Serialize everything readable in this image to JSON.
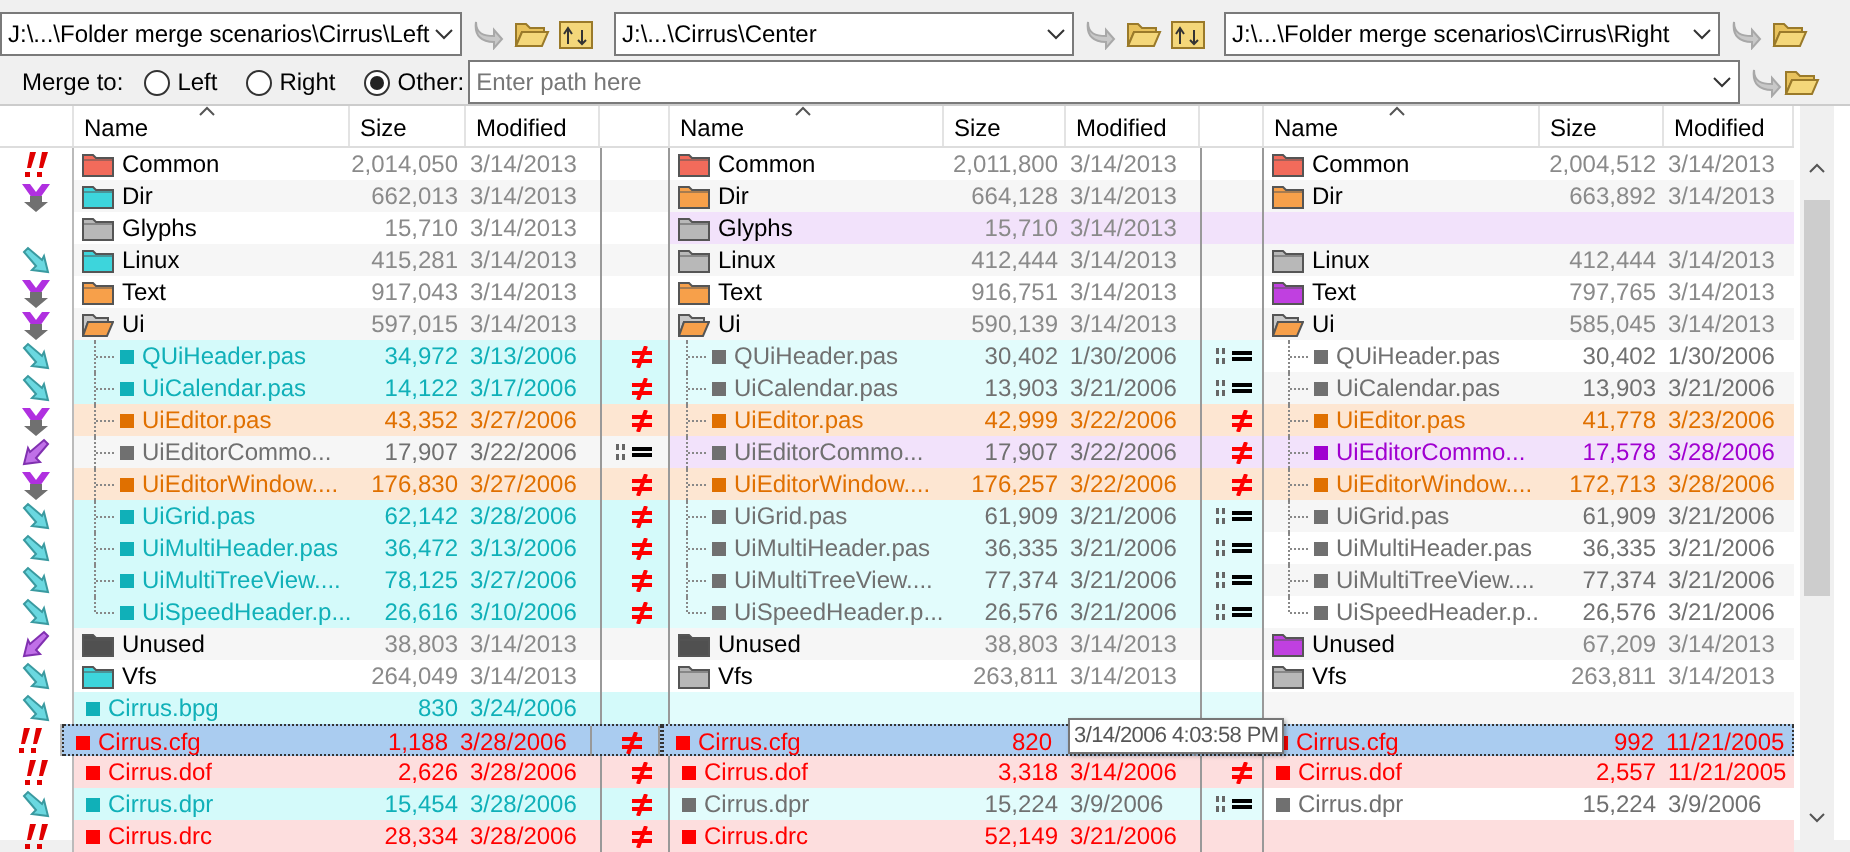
{
  "panes": [
    {
      "path": "J:\\...\\Folder merge scenarios\\Cirrus\\Left",
      "columns": [
        "Name",
        "Size",
        "Modified"
      ]
    },
    {
      "path": "J:\\...\\Cirrus\\Center",
      "columns": [
        "Name",
        "Size",
        "Modified"
      ]
    },
    {
      "path": "J:\\...\\Folder merge scenarios\\Cirrus\\Right",
      "columns": [
        "Name",
        "Size",
        "Modified"
      ]
    }
  ],
  "merge_to": {
    "label": "Merge to:",
    "options": [
      {
        "label": "Left",
        "selected": false
      },
      {
        "label": "Right",
        "selected": false
      },
      {
        "label": "Other:",
        "selected": true
      }
    ],
    "path": {
      "placeholder": "Enter path here"
    }
  },
  "rows": [
    {
      "kind": "conflict",
      "selected": false,
      "left": {
        "name": "Common",
        "size": "2,014,050",
        "modified": "3/14/2013",
        "kind": "folder",
        "color": "#f26b5b"
      },
      "center": {
        "name": "Common",
        "size": "2,011,800",
        "modified": "3/14/2013",
        "kind": "folder",
        "color": "#f26b5b"
      },
      "right": {
        "name": "Common",
        "size": "2,004,512",
        "modified": "3/14/2013",
        "kind": "folder",
        "color": "#f26b5b"
      }
    },
    {
      "kind": "merge",
      "selected": false,
      "left": {
        "name": "Dir",
        "size": "662,013",
        "modified": "3/14/2013",
        "kind": "folder",
        "color": "#3dd5dc"
      },
      "center": {
        "name": "Dir",
        "size": "664,128",
        "modified": "3/14/2013",
        "kind": "folder",
        "color": "#f7a04a"
      },
      "right": {
        "name": "Dir",
        "size": "663,892",
        "modified": "3/14/2013",
        "kind": "folder",
        "color": "#f7a04a"
      }
    },
    {
      "selected": false,
      "left": {
        "name": "Glyphs",
        "size": "15,710",
        "modified": "3/14/2013",
        "kind": "folder",
        "color": "#b8b8b8"
      },
      "center": {
        "name": "Glyphs",
        "size": "15,710",
        "modified": "3/14/2013",
        "kind": "folder",
        "color": "#b8b8b8",
        "shade": {
          "color": "#f2e2fb"
        }
      },
      "right": {
        "shade": {
          "color": "#f2e2fb"
        }
      }
    },
    {
      "kind": "copy_right",
      "selected": false,
      "left": {
        "name": "Linux",
        "size": "415,281",
        "modified": "3/14/2013",
        "kind": "folder",
        "color": "#3dd5dc"
      },
      "center": {
        "name": "Linux",
        "size": "412,444",
        "modified": "3/14/2013",
        "kind": "folder",
        "color": "#b8b8b8"
      },
      "right": {
        "name": "Linux",
        "size": "412,444",
        "modified": "3/14/2013",
        "kind": "folder",
        "color": "#b8b8b8"
      }
    },
    {
      "kind": "merge",
      "selected": false,
      "left": {
        "name": "Text",
        "size": "917,043",
        "modified": "3/14/2013",
        "kind": "folder",
        "color": "#f7a04a"
      },
      "center": {
        "name": "Text",
        "size": "916,751",
        "modified": "3/14/2013",
        "kind": "folder",
        "color": "#f7a04a"
      },
      "right": {
        "name": "Text",
        "size": "797,765",
        "modified": "3/14/2013",
        "kind": "folder",
        "color": "#c040e0"
      }
    },
    {
      "kind": "merge",
      "selected": false,
      "left": {
        "name": "Ui",
        "size": "597,015",
        "modified": "3/14/2013",
        "kind": "open_folder",
        "color": "#f7a04a"
      },
      "center": {
        "name": "Ui",
        "size": "590,139",
        "modified": "3/14/2013",
        "kind": "open_folder",
        "color": "#f7a04a"
      },
      "right": {
        "name": "Ui",
        "size": "585,045",
        "modified": "3/14/2013",
        "kind": "open_folder",
        "color": "#f7a04a"
      },
      "children": [
        {
          "kind": "copy_right",
          "selected": false,
          "compare_left": {
            "kind": "ne"
          },
          "compare_right": {
            "kind": "eq"
          },
          "left": {
            "name": "QUiHeader.pas",
            "size": "34,972",
            "modified": "3/13/2006",
            "kind": "file",
            "color": "#10b0b8",
            "shade": {
              "color": "#d4fafa"
            }
          },
          "center": {
            "name": "QUiHeader.pas",
            "size": "30,402",
            "modified": "1/30/2006",
            "kind": "file",
            "color": "#707070",
            "shade": {
              "color": "#e2fcfc"
            }
          },
          "right": {
            "name": "QUiHeader.pas",
            "size": "30,402",
            "modified": "1/30/2006",
            "kind": "file",
            "color": "#707070"
          }
        },
        {
          "kind": "copy_right",
          "selected": false,
          "compare_left": {
            "kind": "ne"
          },
          "compare_right": {
            "kind": "eq"
          },
          "left": {
            "name": "UiCalendar.pas",
            "size": "14,122",
            "modified": "3/17/2006",
            "kind": "file",
            "color": "#10b0b8",
            "shade": {
              "color": "#d4fafa"
            }
          },
          "center": {
            "name": "UiCalendar.pas",
            "size": "13,903",
            "modified": "3/21/2006",
            "kind": "file",
            "color": "#707070",
            "shade": {
              "color": "#e2fcfc"
            }
          },
          "right": {
            "name": "UiCalendar.pas",
            "size": "13,903",
            "modified": "3/21/2006",
            "kind": "file",
            "color": "#707070"
          }
        },
        {
          "kind": "merge",
          "selected": false,
          "compare_left": {
            "kind": "ne"
          },
          "compare_right": {
            "kind": "ne"
          },
          "left": {
            "name": "UiEditor.pas",
            "size": "43,352",
            "modified": "3/27/2006",
            "kind": "file",
            "color": "#e07000",
            "shade": {
              "color": "#fde6d2"
            }
          },
          "center": {
            "name": "UiEditor.pas",
            "size": "42,999",
            "modified": "3/22/2006",
            "kind": "file",
            "color": "#e07000",
            "shade": {
              "color": "#fde6d2"
            }
          },
          "right": {
            "name": "UiEditor.pas",
            "size": "41,778",
            "modified": "3/23/2006",
            "kind": "file",
            "color": "#e07000",
            "shade": {
              "color": "#fde6d2"
            }
          }
        },
        {
          "kind": "copy_left",
          "selected": false,
          "compare_left": {
            "kind": "eq"
          },
          "compare_right": {
            "kind": "ne"
          },
          "left": {
            "name": "UiEditorCommo...",
            "size": "17,907",
            "modified": "3/22/2006",
            "kind": "file",
            "color": "#707070"
          },
          "center": {
            "name": "UiEditorCommo...",
            "size": "17,907",
            "modified": "3/22/2006",
            "kind": "file",
            "color": "#707070",
            "shade": {
              "color": "#f2e2fb"
            }
          },
          "right": {
            "name": "UiEditorCommo...",
            "size": "17,578",
            "modified": "3/28/2006",
            "kind": "file",
            "color": "#a000d0",
            "shade": {
              "color": "#f2e2fb"
            }
          }
        },
        {
          "kind": "merge",
          "selected": false,
          "compare_left": {
            "kind": "ne"
          },
          "compare_right": {
            "kind": "ne"
          },
          "left": {
            "name": "UiEditorWindow....",
            "size": "176,830",
            "modified": "3/27/2006",
            "kind": "file",
            "color": "#e07000",
            "shade": {
              "color": "#fde6d2"
            }
          },
          "center": {
            "name": "UiEditorWindow....",
            "size": "176,257",
            "modified": "3/22/2006",
            "kind": "file",
            "color": "#e07000",
            "shade": {
              "color": "#fde6d2"
            }
          },
          "right": {
            "name": "UiEditorWindow....",
            "size": "172,713",
            "modified": "3/28/2006",
            "kind": "file",
            "color": "#e07000",
            "shade": {
              "color": "#fde6d2"
            }
          }
        },
        {
          "kind": "copy_right",
          "selected": false,
          "compare_left": {
            "kind": "ne"
          },
          "compare_right": {
            "kind": "eq"
          },
          "left": {
            "name": "UiGrid.pas",
            "size": "62,142",
            "modified": "3/28/2006",
            "kind": "file",
            "color": "#10b0b8",
            "shade": {
              "color": "#d4fafa"
            }
          },
          "center": {
            "name": "UiGrid.pas",
            "size": "61,909",
            "modified": "3/21/2006",
            "kind": "file",
            "color": "#707070",
            "shade": {
              "color": "#e2fcfc"
            }
          },
          "right": {
            "name": "UiGrid.pas",
            "size": "61,909",
            "modified": "3/21/2006",
            "kind": "file",
            "color": "#707070"
          }
        },
        {
          "kind": "copy_right",
          "selected": false,
          "compare_left": {
            "kind": "ne"
          },
          "compare_right": {
            "kind": "eq"
          },
          "left": {
            "name": "UiMultiHeader.pas",
            "size": "36,472",
            "modified": "3/13/2006",
            "kind": "file",
            "color": "#10b0b8",
            "shade": {
              "color": "#d4fafa"
            }
          },
          "center": {
            "name": "UiMultiHeader.pas",
            "size": "36,335",
            "modified": "3/21/2006",
            "kind": "file",
            "color": "#707070",
            "shade": {
              "color": "#e2fcfc"
            }
          },
          "right": {
            "name": "UiMultiHeader.pas",
            "size": "36,335",
            "modified": "3/21/2006",
            "kind": "file",
            "color": "#707070"
          }
        },
        {
          "kind": "copy_right",
          "selected": false,
          "compare_left": {
            "kind": "ne"
          },
          "compare_right": {
            "kind": "eq"
          },
          "left": {
            "name": "UiMultiTreeView....",
            "size": "78,125",
            "modified": "3/27/2006",
            "kind": "file",
            "color": "#10b0b8",
            "shade": {
              "color": "#d4fafa"
            }
          },
          "center": {
            "name": "UiMultiTreeView....",
            "size": "77,374",
            "modified": "3/21/2006",
            "kind": "file",
            "color": "#707070",
            "shade": {
              "color": "#e2fcfc"
            }
          },
          "right": {
            "name": "UiMultiTreeView....",
            "size": "77,374",
            "modified": "3/21/2006",
            "kind": "file",
            "color": "#707070"
          }
        },
        {
          "kind": "copy_right",
          "selected": false,
          "compare_left": {
            "kind": "ne"
          },
          "compare_right": {
            "kind": "eq"
          },
          "left": {
            "name": "UiSpeedHeader.p...",
            "size": "26,616",
            "modified": "3/10/2006",
            "kind": "file",
            "color": "#10b0b8",
            "shade": {
              "color": "#d4fafa"
            }
          },
          "center": {
            "name": "UiSpeedHeader.p...",
            "size": "26,576",
            "modified": "3/21/2006",
            "kind": "file",
            "color": "#707070",
            "shade": {
              "color": "#e2fcfc"
            }
          },
          "right": {
            "name": "UiSpeedHeader.p...",
            "size": "26,576",
            "modified": "3/21/2006",
            "kind": "file",
            "color": "#707070"
          }
        }
      ]
    },
    {
      "kind": "copy_left",
      "selected": false,
      "left": {
        "name": "Unused",
        "size": "38,803",
        "modified": "3/14/2013",
        "kind": "folder",
        "color": "#505050"
      },
      "center": {
        "name": "Unused",
        "size": "38,803",
        "modified": "3/14/2013",
        "kind": "folder",
        "color": "#505050"
      },
      "right": {
        "name": "Unused",
        "size": "67,209",
        "modified": "3/14/2013",
        "kind": "folder",
        "color": "#c040e0"
      }
    },
    {
      "kind": "copy_right",
      "selected": false,
      "left": {
        "name": "Vfs",
        "size": "264,049",
        "modified": "3/14/2013",
        "kind": "folder",
        "color": "#3dd5dc"
      },
      "center": {
        "name": "Vfs",
        "size": "263,811",
        "modified": "3/14/2013",
        "kind": "folder",
        "color": "#b8b8b8"
      },
      "right": {
        "name": "Vfs",
        "size": "263,811",
        "modified": "3/14/2013",
        "kind": "folder",
        "color": "#b8b8b8"
      }
    },
    {
      "kind": "copy_right",
      "selected": false,
      "left": {
        "name": "Cirrus.bpg",
        "size": "830",
        "modified": "3/24/2006",
        "kind": "file",
        "color": "#10b0b8",
        "shade": {
          "color": "#d4fafa"
        }
      },
      "center": {
        "shade": {
          "color": "#e2fcfc"
        }
      }
    },
    {
      "kind": "conflict",
      "selected": true,
      "compare_left": {
        "kind": "ne"
      },
      "left": {
        "name": "Cirrus.cfg",
        "size": "1,188",
        "modified": "3/28/2006",
        "kind": "file",
        "color": "#ff0000"
      },
      "center": {
        "name": "Cirrus.cfg",
        "size": "820",
        "kind": "file",
        "color": "#ff0000"
      },
      "right": {
        "name": "Cirrus.cfg",
        "size": "992",
        "modified": "11/21/2005",
        "kind": "file",
        "color": "#ff0000"
      }
    },
    {
      "kind": "conflict",
      "selected": false,
      "compare_left": {
        "kind": "ne"
      },
      "compare_right": {
        "kind": "ne"
      },
      "left": {
        "name": "Cirrus.dof",
        "size": "2,626",
        "modified": "3/28/2006",
        "kind": "file",
        "color": "#ff0000",
        "shade": {
          "color": "#fddede"
        }
      },
      "center": {
        "name": "Cirrus.dof",
        "size": "3,318",
        "modified": "3/14/2006",
        "kind": "file",
        "color": "#ff0000",
        "shade": {
          "color": "#fddede"
        }
      },
      "right": {
        "name": "Cirrus.dof",
        "size": "2,557",
        "modified": "11/21/2005",
        "kind": "file",
        "color": "#ff0000",
        "shade": {
          "color": "#fddede"
        }
      }
    },
    {
      "kind": "copy_right",
      "selected": false,
      "compare_left": {
        "kind": "ne"
      },
      "compare_right": {
        "kind": "eq"
      },
      "left": {
        "name": "Cirrus.dpr",
        "size": "15,454",
        "modified": "3/28/2006",
        "kind": "file",
        "color": "#10b0b8",
        "shade": {
          "color": "#d4fafa"
        }
      },
      "center": {
        "name": "Cirrus.dpr",
        "size": "15,224",
        "modified": "3/9/2006",
        "kind": "file",
        "color": "#707070",
        "shade": {
          "color": "#e2fcfc"
        }
      },
      "right": {
        "name": "Cirrus.dpr",
        "size": "15,224",
        "modified": "3/9/2006",
        "kind": "file",
        "color": "#707070"
      }
    },
    {
      "kind": "conflict",
      "selected": false,
      "compare_left": {
        "kind": "ne"
      },
      "left": {
        "name": "Cirrus.drc",
        "size": "28,334",
        "modified": "3/28/2006",
        "kind": "file",
        "color": "#ff0000",
        "shade": {
          "color": "#fddede"
        }
      },
      "center": {
        "name": "Cirrus.drc",
        "size": "52,149",
        "modified": "3/21/2006",
        "kind": "file",
        "color": "#ff0000",
        "shade": {
          "color": "#fddede"
        }
      },
      "right": {
        "shade": {
          "color": "#fddede"
        }
      }
    }
  ],
  "tooltip": {
    "text": "3/14/2006 4:03:58 PM"
  }
}
